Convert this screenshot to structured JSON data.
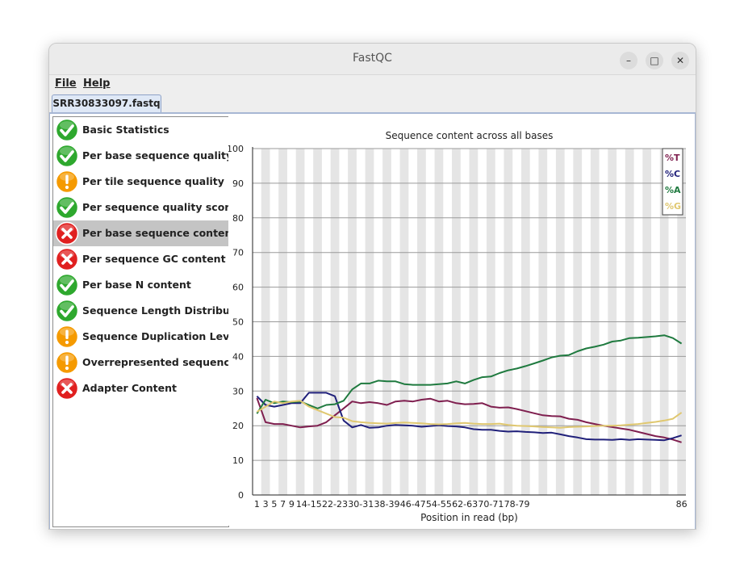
{
  "window": {
    "title": "FastQC",
    "controls": {
      "minimize": "–",
      "maximize": "□",
      "close": "✕"
    }
  },
  "menu": {
    "file": "File",
    "help": "Help"
  },
  "tab": {
    "label": "SRR30833097.fastq"
  },
  "modules": [
    {
      "label": "Basic Statistics",
      "status": "pass"
    },
    {
      "label": "Per base sequence quality",
      "status": "pass"
    },
    {
      "label": "Per tile sequence quality",
      "status": "warn"
    },
    {
      "label": "Per sequence quality scores",
      "status": "pass"
    },
    {
      "label": "Per base sequence content",
      "status": "fail",
      "selected": true
    },
    {
      "label": "Per sequence GC content",
      "status": "fail"
    },
    {
      "label": "Per base N content",
      "status": "pass"
    },
    {
      "label": "Sequence Length Distribution",
      "status": "pass"
    },
    {
      "label": "Sequence Duplication Levels",
      "status": "warn"
    },
    {
      "label": "Overrepresented sequences",
      "status": "warn"
    },
    {
      "label": "Adapter Content",
      "status": "fail"
    }
  ],
  "status_colors": {
    "pass": "#2ea82e",
    "warn": "#f59a00",
    "fail": "#e02020"
  },
  "chart_data": {
    "type": "line",
    "title": "Sequence content across all bases",
    "xlabel": "Position in read (bp)",
    "ylabel": "",
    "ylim": [
      0,
      100
    ],
    "yticks": [
      "0",
      "10",
      "20",
      "30",
      "40",
      "50",
      "60",
      "70",
      "80",
      "90",
      "100"
    ],
    "xticks": [
      "1",
      "3",
      "5",
      "7",
      "9",
      "14-15",
      "22-23",
      "30-31",
      "38-39",
      "46-47",
      "54-55",
      "62-63",
      "70-71",
      "78-79",
      "86"
    ],
    "grid": true,
    "legend_position": "top-right",
    "n_positions": 50,
    "series": [
      {
        "name": "%T",
        "color": "#7f1f4f",
        "values": [
          28,
          21,
          20.5,
          20.5,
          20,
          19.5,
          19.8,
          20,
          21,
          23,
          25,
          27,
          26.5,
          26.8,
          26.5,
          26,
          27,
          27.2,
          27,
          27.5,
          27.8,
          27,
          27.2,
          26.5,
          26.2,
          26.3,
          26.5,
          25.5,
          25.2,
          25.3,
          24.8,
          24.2,
          23.6,
          23,
          22.8,
          22.7,
          22,
          21.7,
          21,
          20.5,
          20,
          19.6,
          19.2,
          18.8,
          18.2,
          17.6,
          17,
          16.6,
          16,
          15.2
        ]
      },
      {
        "name": "%C",
        "color": "#20207a",
        "values": [
          28.5,
          26,
          25.5,
          26,
          26.5,
          26.5,
          29.5,
          29.5,
          29.5,
          28.5,
          21.5,
          19.5,
          20.2,
          19.4,
          19.5,
          20,
          20.2,
          20.1,
          20,
          19.7,
          19.9,
          20.1,
          19.9,
          19.8,
          19.5,
          19,
          18.8,
          18.8,
          18.5,
          18.3,
          18.4,
          18.2,
          18.1,
          17.9,
          18,
          17.5,
          17,
          16.6,
          16.1,
          16,
          16,
          15.9,
          16.1,
          15.9,
          16.1,
          16,
          15.9,
          15.8,
          16.4,
          17.2
        ]
      },
      {
        "name": "%A",
        "color": "#1f7a3f",
        "values": [
          23.5,
          27.5,
          26.5,
          27,
          26.8,
          27,
          26,
          25,
          26,
          26.2,
          27.2,
          30.5,
          32.2,
          32.2,
          33,
          32.8,
          32.8,
          32,
          31.8,
          31.8,
          31.8,
          32,
          32.2,
          32.8,
          32.2,
          33.2,
          34,
          34.2,
          35.2,
          36,
          36.5,
          37.2,
          38,
          38.8,
          39.7,
          40.2,
          40.4,
          41.5,
          42.3,
          42.8,
          43.4,
          44.3,
          44.6,
          45.3,
          45.4,
          45.6,
          45.8,
          46.1,
          45.3,
          43.7
        ]
      },
      {
        "name": "%G",
        "color": "#e0c870",
        "values": [
          24,
          25.5,
          27,
          26.5,
          27,
          27.2,
          25.5,
          24.5,
          23.5,
          22.5,
          22.3,
          21.3,
          21,
          20.8,
          20.7,
          20.6,
          20.8,
          20.9,
          20.8,
          20.7,
          20.5,
          20.4,
          20.5,
          20.7,
          20.8,
          20.6,
          20.5,
          20.5,
          20.6,
          20.2,
          20,
          19.9,
          19.8,
          19.6,
          19.5,
          19.4,
          19.6,
          19.7,
          19.8,
          19.9,
          20,
          20,
          20.1,
          20.3,
          20.5,
          20.8,
          21.1,
          21.5,
          22,
          23.8
        ]
      }
    ]
  }
}
